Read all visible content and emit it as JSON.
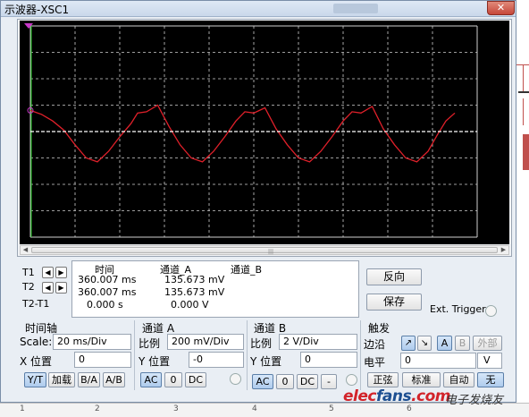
{
  "window": {
    "title": "示波器-XSC1",
    "close_label": "✕"
  },
  "colors": {
    "trace_a": "#e0202a",
    "trace_b": "#ffffff",
    "grid": "#cfcfcf",
    "screen_bg": "#000000",
    "cursor": "#c838c8"
  },
  "cursors": {
    "t1_label": "T1",
    "t2_label": "T2",
    "t2t1_label": "T2-T1",
    "left_icon": "arrow-left-icon",
    "right_icon": "arrow-right-icon"
  },
  "readout": {
    "headers": [
      "时间",
      "通道_A",
      "通道_B"
    ],
    "rows": [
      {
        "time": "360.007 ms",
        "ch_a": "135.673 mV",
        "ch_b": ""
      },
      {
        "time": "360.007 ms",
        "ch_a": "135.673 mV",
        "ch_b": ""
      },
      {
        "time": "0.000 s",
        "ch_a": "0.000 V",
        "ch_b": ""
      }
    ]
  },
  "buttons": {
    "reverse": "反向",
    "save": "保存",
    "ext_trigger": "Ext. Trigger"
  },
  "timebase": {
    "group": "时间轴",
    "scale_label": "Scale:",
    "scale_value": "20 ms/Div",
    "xpos_label": "X 位置",
    "xpos_value": "0",
    "modes": [
      "Y/T",
      "加载",
      "B/A",
      "A/B"
    ],
    "active_mode": "Y/T"
  },
  "channel_a": {
    "group": "通道 A",
    "scale_label": "比例",
    "scale_value": "200 mV/Div",
    "ypos_label": "Y 位置",
    "ypos_value": "-0",
    "coupling": [
      "AC",
      "0",
      "DC"
    ],
    "active_coupling": "AC"
  },
  "channel_b": {
    "group": "通道 B",
    "scale_label": "比例",
    "scale_value": "2  V/Div",
    "ypos_label": "Y 位置",
    "ypos_value": "0",
    "coupling": [
      "AC",
      "0",
      "DC",
      "-"
    ],
    "active_coupling": "AC"
  },
  "trigger": {
    "group": "触发",
    "edge_label": "边沿",
    "edge_buttons": [
      "rising-edge-icon",
      "falling-edge-icon"
    ],
    "source_buttons": [
      "A",
      "B",
      "外部"
    ],
    "active_source": "A",
    "level_label": "电平",
    "level_value": "0",
    "level_unit": "V",
    "types": [
      "正弦",
      "标准",
      "自动",
      "无"
    ],
    "active_type": "无"
  },
  "ruler": [
    "1",
    "2",
    "3",
    "4",
    "5",
    "6"
  ],
  "watermark": {
    "logo_a": "elec",
    "logo_b": "fans",
    "logo_c": ".com",
    "cn": "电子发烧友"
  },
  "chart_data": {
    "type": "line",
    "title": "",
    "xlabel": "",
    "ylabel": "",
    "x_divs": 10,
    "y_divs": 8,
    "x_per_div_ms": 20,
    "y_per_div_mV": 200,
    "series": [
      {
        "color": "#e0202a",
        "x_div": [
          0,
          0.25,
          0.5,
          0.75,
          1.0,
          1.25,
          1.5,
          1.75,
          2.0,
          2.25,
          2.4,
          2.6,
          2.85,
          3.1,
          3.35,
          3.6,
          3.85,
          4.1,
          4.35,
          4.6,
          4.8,
          5.0,
          5.25,
          5.5,
          5.75,
          6.0,
          6.25,
          6.5,
          6.75,
          7.0,
          7.2,
          7.4,
          7.65,
          7.9,
          8.15,
          8.4,
          8.65,
          8.9,
          9.1,
          9.3,
          9.5
        ],
        "y_mV": [
          160,
          130,
          80,
          10,
          -100,
          -200,
          -230,
          -150,
          -40,
          60,
          140,
          150,
          200,
          40,
          -100,
          -200,
          -230,
          -150,
          -40,
          80,
          150,
          140,
          180,
          20,
          -100,
          -200,
          -230,
          -150,
          -40,
          80,
          150,
          140,
          190,
          20,
          -100,
          -200,
          -230,
          -150,
          -30,
          80,
          140
        ]
      },
      {
        "color": "#ffffff",
        "x_div": [
          0,
          10
        ],
        "y_mV": [
          0,
          0
        ]
      }
    ]
  }
}
